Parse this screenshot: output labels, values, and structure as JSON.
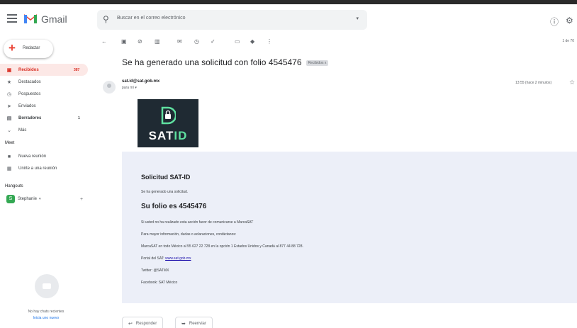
{
  "app": {
    "name": "Gmail"
  },
  "search": {
    "placeholder": "Buscar en el correo electrónico"
  },
  "sidebar": {
    "compose_label": "Redactar",
    "items": [
      {
        "label": "Recibidos",
        "count": "387",
        "icon": "inbox-icon"
      },
      {
        "label": "Destacados",
        "count": "",
        "icon": "star-icon"
      },
      {
        "label": "Pospuestos",
        "count": "",
        "icon": "clock-icon"
      },
      {
        "label": "Enviados",
        "count": "",
        "icon": "send-icon"
      },
      {
        "label": "Borradores",
        "count": "1",
        "icon": "draft-icon"
      },
      {
        "label": "Más",
        "count": "",
        "icon": "chevron-down-icon"
      }
    ],
    "meet": {
      "title": "Meet",
      "items": [
        {
          "label": "Nueva reunión",
          "icon": "video-icon"
        },
        {
          "label": "Unirte a una reunión",
          "icon": "keyboard-icon"
        }
      ]
    },
    "hangouts": {
      "title": "Hangouts",
      "user": "Stephanie",
      "avatar_letter": "S"
    },
    "no_chats": "No hay chats recientes",
    "start_new": "Inicia uno nuevo"
  },
  "toolbar": {
    "page_info": "1 de 70"
  },
  "message": {
    "subject": "Se ha generado una solicitud con folio 4545476",
    "label": "Recibidos x",
    "sender": "sat.id@sat.gob.mx",
    "to": "para mí ▾",
    "time": "13:55 (hace 2 minutos)",
    "logo_text": "SAT",
    "logo_id": "ID",
    "body": {
      "title": "Solicitud SAT-ID",
      "line1": "Se ha generado una solicitud.",
      "folio": "Su folio es 4545476",
      "line2": "Si usted no ha realizado esta acción favor de comunicarse a MarcaSAT",
      "line3": "Para mayor información, dudas o aclaraciones, contáctanos:",
      "line4": "MarcaSAT en todo México al 55 627 22 728 en la opción 1 Estados Unidos y Canadá al 877 44 88 728.",
      "portal_label": "Portal del SAT: ",
      "portal_link": "www.sat.gob.mx",
      "twitter": "Twitter: @SATMX",
      "facebook": "Facebook: SAT México"
    }
  },
  "actions": {
    "reply": "Responder",
    "forward": "Reenviar"
  },
  "colors": {
    "accent": "#d93025",
    "logo_bg": "#1f2a33",
    "logo_id": "#5fe0a0",
    "body_bg": "#eceff8"
  }
}
